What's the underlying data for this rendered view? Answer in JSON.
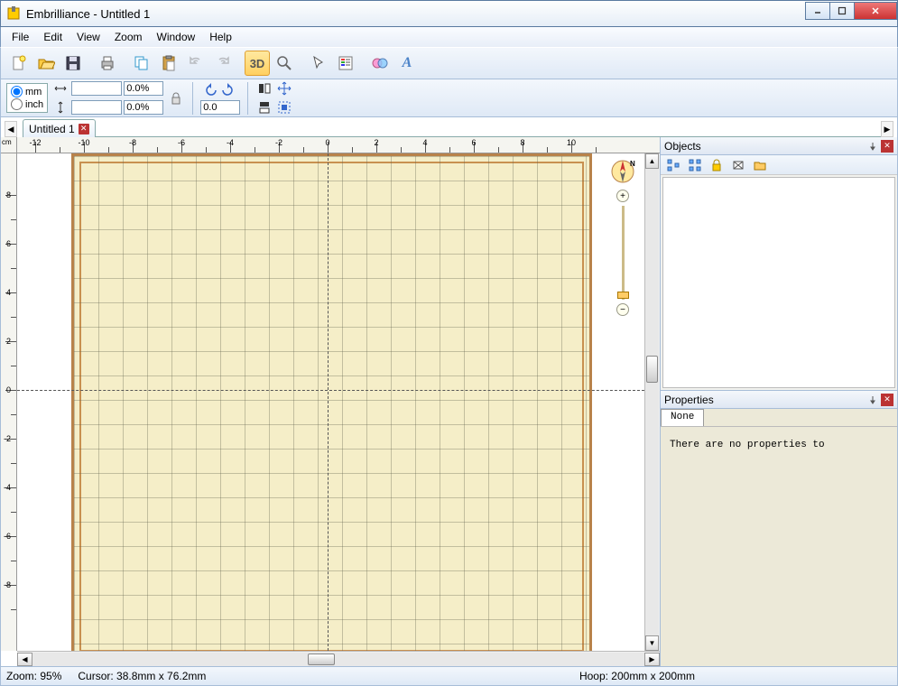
{
  "title": "Embrilliance -  Untitled 1",
  "menu": {
    "file": "File",
    "edit": "Edit",
    "view": "View",
    "zoom": "Zoom",
    "window": "Window",
    "help": "Help"
  },
  "toolbar": {
    "new": "new",
    "open": "open",
    "save": "save",
    "print": "print",
    "copy": "copy",
    "paste": "paste",
    "undo": "undo",
    "redo": "redo",
    "view3d": "3D",
    "zoomtool": "zoom",
    "select": "select",
    "props": "props",
    "merge": "merge",
    "text": "text"
  },
  "units": {
    "mm": "mm",
    "inch": "inch",
    "selected": "mm"
  },
  "dims": {
    "w": "",
    "h": "",
    "wp": "0.0%",
    "hp": "0.0%",
    "rot": "0.0"
  },
  "tabs": {
    "doc1": "Untitled 1"
  },
  "ruler": {
    "unit": "cm",
    "h": [
      -12,
      -10,
      -8,
      -6,
      -4,
      -2,
      0,
      2,
      4,
      6,
      8,
      10
    ],
    "v": [
      8,
      6,
      4,
      2,
      0,
      -2,
      -4,
      -6,
      -8
    ]
  },
  "panels": {
    "objects": "Objects",
    "properties": "Properties",
    "proptab": "None",
    "propmsg": "There are no properties to"
  },
  "status": {
    "zoom": "Zoom: 95%",
    "cursor": "Cursor: 38.8mm x 76.2mm",
    "hoop": "Hoop:  200mm x 200mm"
  }
}
